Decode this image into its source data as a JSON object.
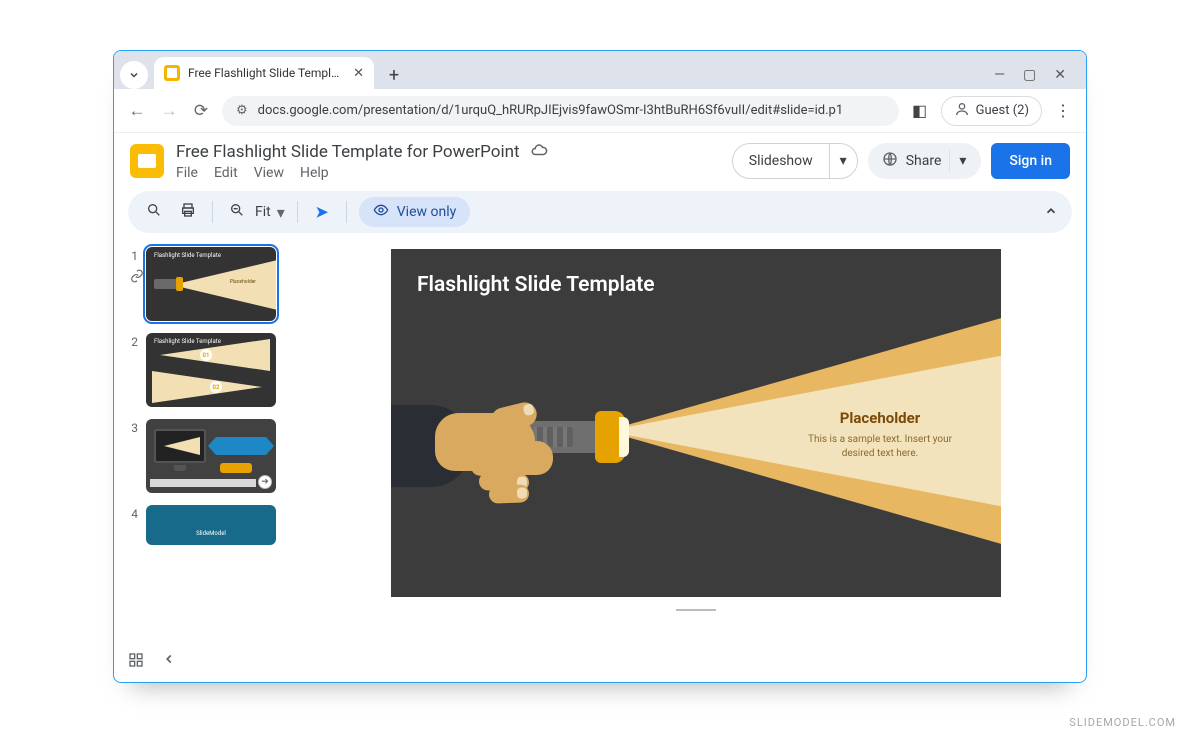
{
  "browser": {
    "tab_title": "Free Flashlight Slide Template f",
    "url": "docs.google.com/presentation/d/1urquQ_hRURpJIEjvis9fawOSmr-I3htBuRH6Sf6vuII/edit#slide=id.p1",
    "guest_label": "Guest (2)"
  },
  "docs": {
    "title": "Free Flashlight Slide Template for PowerPoint",
    "menus": {
      "file": "File",
      "edit": "Edit",
      "view": "View",
      "help": "Help"
    },
    "slideshow_label": "Slideshow",
    "share_label": "Share",
    "signin_label": "Sign in"
  },
  "toolbar": {
    "zoom_label": "Fit",
    "view_mode_label": "View only"
  },
  "filmstrip": {
    "slides": [
      {
        "num": "1",
        "title": "Flashlight Slide Template",
        "label": "Placeholder"
      },
      {
        "num": "2",
        "title": "Flashlight Slide Template",
        "badge1": "01",
        "badge2": "02"
      },
      {
        "num": "3"
      },
      {
        "num": "4",
        "brand": "SlideModel"
      }
    ]
  },
  "slide": {
    "title": "Flashlight Slide Template",
    "placeholder_title": "Placeholder",
    "placeholder_text": "This is a sample text. Insert your desired text here."
  },
  "watermark": "SLIDEMODEL.COM"
}
